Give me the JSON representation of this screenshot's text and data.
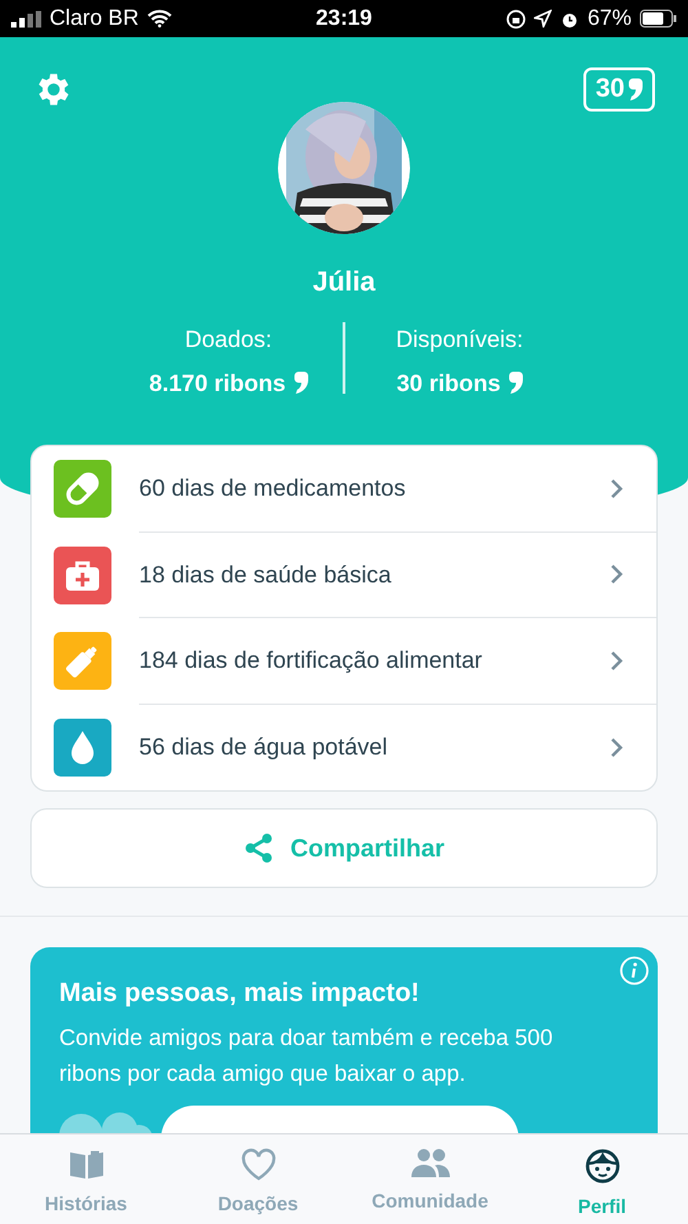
{
  "status_bar": {
    "carrier": "Claro BR",
    "time": "23:19",
    "battery": "67%"
  },
  "header": {
    "balance_badge": "30",
    "name": "Júlia",
    "stats": [
      {
        "label": "Doados:",
        "value": "8.170 ribons"
      },
      {
        "label": "Disponíveis:",
        "value": "30 ribons"
      }
    ]
  },
  "impact_list": [
    {
      "text": "60 dias de medicamentos",
      "color": "#6cc020"
    },
    {
      "text": "18 dias de saúde básica",
      "color": "#ea5455"
    },
    {
      "text": "184 dias de fortificação alimentar",
      "color": "#fdb313"
    },
    {
      "text": "56 dias de água potável",
      "color": "#19a9c2"
    }
  ],
  "share_button": "Compartilhar",
  "promo": {
    "title": "Mais pessoas, mais impacto!",
    "text": "Convide amigos para doar também e receba 500 ribons por cada amigo que baixar o app."
  },
  "tabs": [
    {
      "label": "Histórias",
      "selected": false
    },
    {
      "label": "Doações",
      "selected": false
    },
    {
      "label": "Comunidade",
      "selected": false
    },
    {
      "label": "Perfil",
      "selected": true
    }
  ]
}
